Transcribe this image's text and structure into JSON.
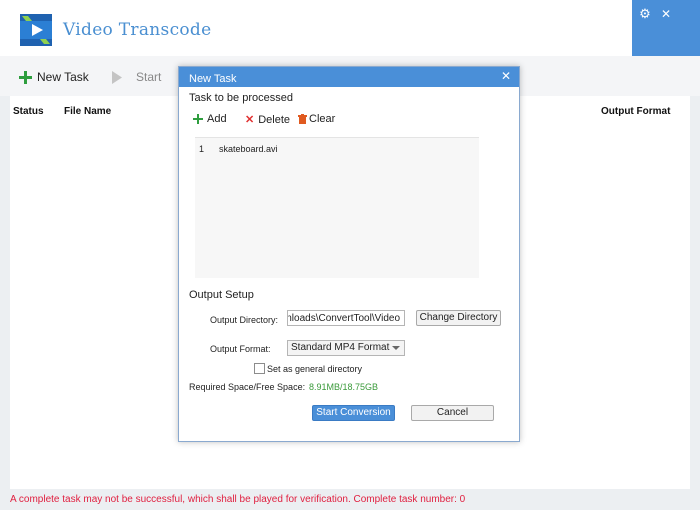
{
  "app": {
    "title": "Video Transcode"
  },
  "toolbar": {
    "new_task": "New Task",
    "start": "Start"
  },
  "table": {
    "columns": {
      "status": "Status",
      "file_name": "File Name",
      "output_format": "Output Format"
    }
  },
  "status_bar": {
    "text": "A complete task may not be successful, which shall be played for verification. Complete task number: 0"
  },
  "dialog": {
    "title": "New Task",
    "task_section": "Task to be processed",
    "actions": {
      "add": "Add",
      "delete": "Delete",
      "clear": "Clear"
    },
    "files": [
      {
        "index": "1",
        "name": "skateboard.avi"
      }
    ],
    "output_setup": "Output Setup",
    "output_directory_label": "Output Directory:",
    "output_directory_value": "C:\\Users\\Public\\Downloads\\ConvertTool\\Video",
    "change_directory": "Change Directory",
    "output_format_label": "Output Format:",
    "output_format_value": "Standard MP4 Format",
    "general_directory_label": "Set as general directory",
    "general_directory_checked": false,
    "space_label": "Required Space/Free Space:",
    "space_value": "8.91MB/18.75GB",
    "start_conversion": "Start Conversion",
    "cancel": "Cancel"
  },
  "colors": {
    "accent": "#4a8fd8",
    "title_text": "#4a8fd1",
    "status_text": "#e02040",
    "space_value": "#3a9a3a",
    "add_icon": "#2e9e3e",
    "delete_icon": "#e03030",
    "clear_icon": "#e05a20"
  },
  "icons": {
    "logo": "video-play-icon",
    "settings": "gear-icon",
    "close": "close-icon",
    "add": "plus-icon",
    "start": "play-icon",
    "delete": "x-icon",
    "clear": "trash-icon"
  }
}
